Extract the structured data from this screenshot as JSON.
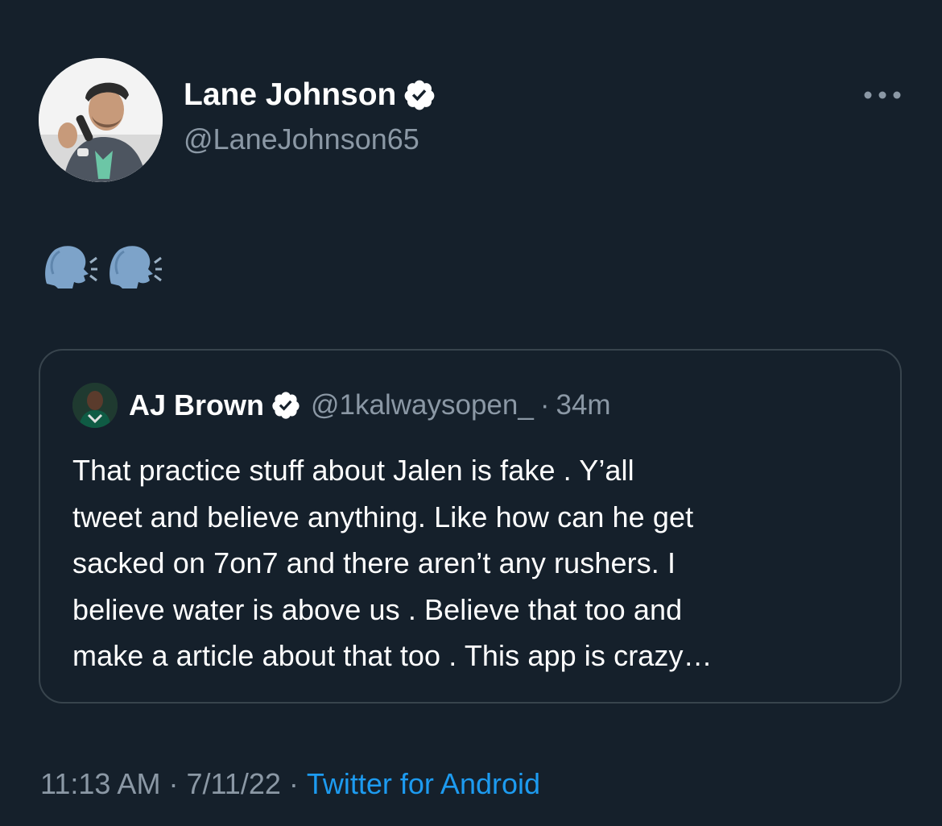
{
  "author": {
    "name": "Lane Johnson",
    "handle": "@LaneJohnson65",
    "verified": true
  },
  "tweet": {
    "emoji_icons": [
      "speaking-head-icon",
      "speaking-head-icon"
    ]
  },
  "quote": {
    "name": "AJ Brown",
    "handle": "@1kalwaysopen_",
    "separator": "·",
    "time": "34m",
    "verified": true,
    "lines": [
      "That practice stuff about Jalen is fake . Y’all",
      "tweet and believe anything. Like how can he get",
      "sacked on 7on7 and there aren’t any rushers. I",
      "believe water is above us . Believe that too and",
      "make a article about that too . This app is crazy…"
    ]
  },
  "footer": {
    "time": "11:13 AM",
    "separator": "·",
    "date": "7/11/22",
    "source": "Twitter for Android"
  },
  "colors": {
    "background": "#15202b",
    "secondary_text": "#8b98a5",
    "link": "#1d9bf0",
    "border": "#38444d"
  }
}
